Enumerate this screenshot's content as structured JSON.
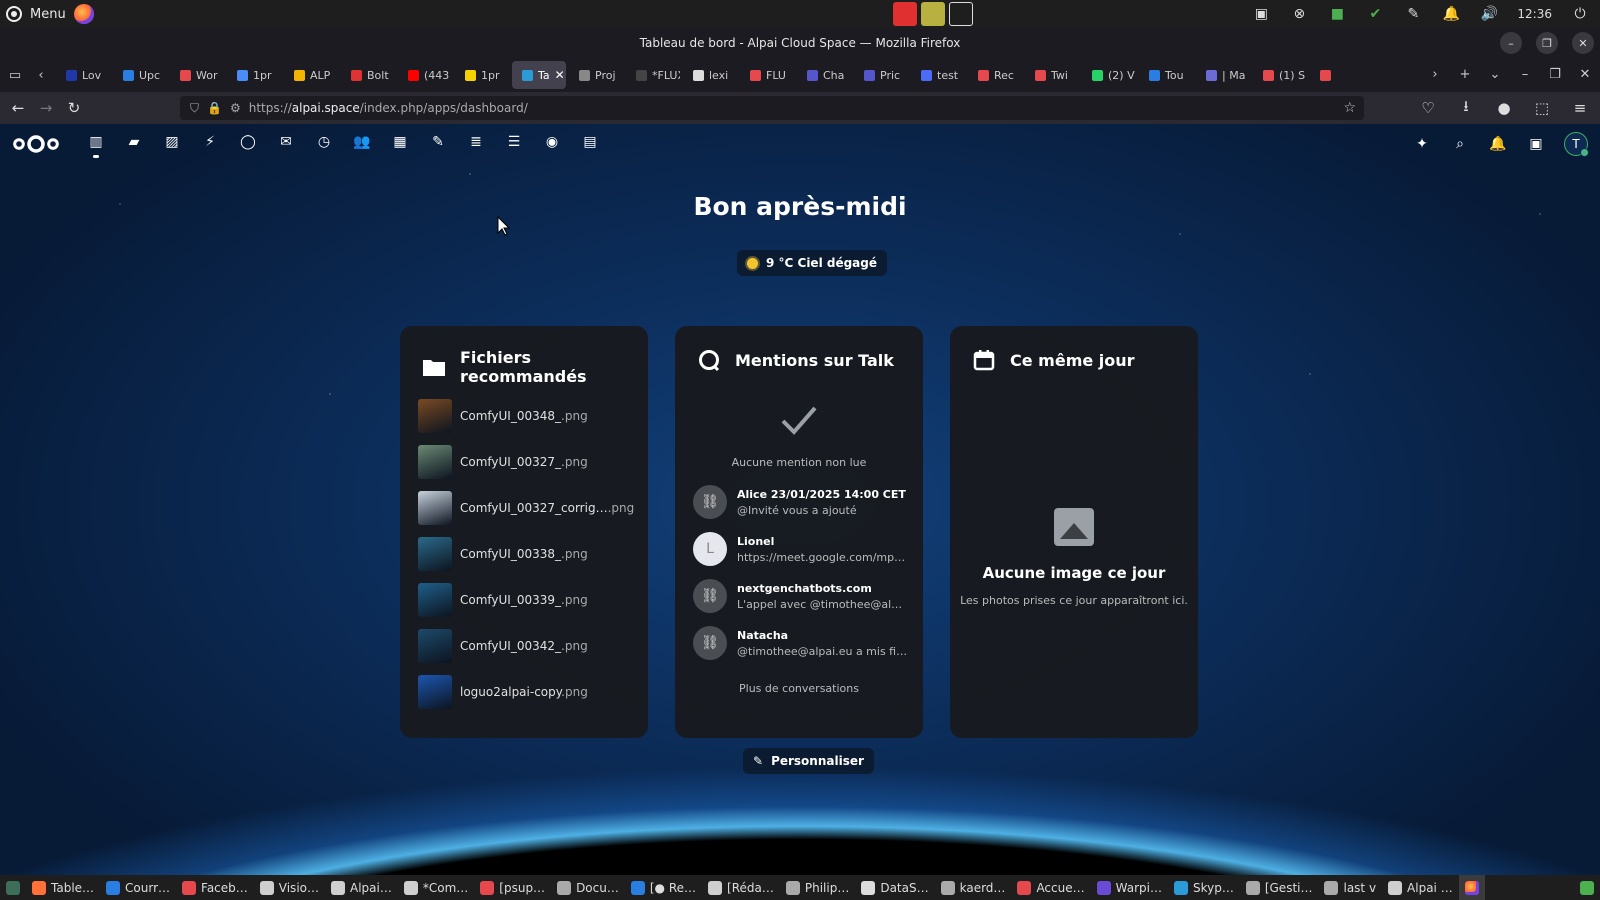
{
  "os": {
    "menu_label": "Menu",
    "clock": "12:36"
  },
  "window": {
    "title": "Tableau de bord - Alpai Cloud Space — Mozilla Firefox"
  },
  "tabs": [
    {
      "label": "Lov",
      "color": "#1f3aa8"
    },
    {
      "label": "Upc",
      "color": "#2a7de1"
    },
    {
      "label": "Wor",
      "color": "#e5484d"
    },
    {
      "label": "1pr",
      "color": "#4a8df6"
    },
    {
      "label": "ALP",
      "color": "#f5b400"
    },
    {
      "label": "Bolt",
      "color": "#d33"
    },
    {
      "label": "(443",
      "color": "#ff0000"
    },
    {
      "label": "1pr",
      "color": "#f5d300"
    },
    {
      "label": "Ta",
      "color": "#2a9bd8",
      "active": true
    },
    {
      "label": "Proj",
      "color": "#888"
    },
    {
      "label": "*FLUX_",
      "color": "#444"
    },
    {
      "label": "lexi",
      "color": "#ddd"
    },
    {
      "label": "FLU",
      "color": "#e5484d"
    },
    {
      "label": "Cha",
      "color": "#5555cc"
    },
    {
      "label": "Pric",
      "color": "#5555cc"
    },
    {
      "label": "test",
      "color": "#4a6cf7"
    },
    {
      "label": "Rec",
      "color": "#e5484d"
    },
    {
      "label": "Twi",
      "color": "#e5484d"
    },
    {
      "label": "(2) V",
      "color": "#25d366"
    },
    {
      "label": "Tou",
      "color": "#2a7de1"
    },
    {
      "label": "| Ma",
      "color": "#6b6bd6"
    },
    {
      "label": "(1) S",
      "color": "#e5484d"
    },
    {
      "label": "",
      "color": "#e5484d"
    }
  ],
  "urlbar": {
    "prefix": "https://",
    "host": "alpai.space",
    "path": "/index.php/apps/dashboard/"
  },
  "dashboard": {
    "greeting": "Bon après-midi",
    "weather": "9 °C Ciel dégagé",
    "customize_label": "Personnaliser",
    "files_panel": {
      "title": "Fichiers recommandés",
      "items": [
        {
          "name": "ComfyUI_00348_",
          "ext": ".png",
          "thumb": "#7a4a22"
        },
        {
          "name": "ComfyUI_00327_",
          "ext": ".png",
          "thumb": "#6b8a74"
        },
        {
          "name": "ComfyUI_00327_corrig…",
          "ext": ".png",
          "thumb": "#c8d3de"
        },
        {
          "name": "ComfyUI_00338_",
          "ext": ".png",
          "thumb": "#2a6a8a"
        },
        {
          "name": "ComfyUI_00339_",
          "ext": ".png",
          "thumb": "#1f5f8a"
        },
        {
          "name": "ComfyUI_00342_",
          "ext": ".png",
          "thumb": "#1d4a6a"
        },
        {
          "name": "loguo2alpai-copy",
          "ext": ".png",
          "thumb": "#1c56b0"
        }
      ]
    },
    "talk_panel": {
      "title": "Mentions sur Talk",
      "empty_text": "Aucune mention non lue",
      "conversations": [
        {
          "title": "Alice 23/01/2025 14:00 CET",
          "sub": "@Invité vous a ajouté",
          "avatar": "link"
        },
        {
          "title": "Lionel",
          "sub": "https://meet.google.com/mpn…",
          "avatar": "L"
        },
        {
          "title": "nextgenchatbots.com",
          "sub": "L'appel avec @timothee@alpa…",
          "avatar": "link"
        },
        {
          "title": "Natacha",
          "sub": "@timothee@alpai.eu a mis fin…",
          "avatar": "link"
        }
      ],
      "more_label": "Plus de conversations"
    },
    "photos_panel": {
      "title": "Ce même jour",
      "empty_title": "Aucune image ce jour",
      "empty_desc": "Les photos prises ce jour apparaîtront ici."
    }
  },
  "nc_header": {
    "avatar_letter": "T",
    "apps": [
      "dashboard-icon",
      "files-icon",
      "photos-icon",
      "activity-icon",
      "talk-icon",
      "mail-icon",
      "deck-icon",
      "contacts-icon",
      "calendar-icon",
      "notes-icon",
      "stack-icon",
      "tasks-icon",
      "circles-icon",
      "calendar2-icon"
    ]
  },
  "taskbar": [
    {
      "label": "Table…",
      "color": "#ff7139",
      "active": false
    },
    {
      "label": "Courr…",
      "color": "#2a7de1"
    },
    {
      "label": "Faceb…",
      "color": "#e5484d"
    },
    {
      "label": "Visio…",
      "color": "#cfcfcf"
    },
    {
      "label": "Alpai…",
      "color": "#cfcfcf"
    },
    {
      "label": "*Com…",
      "color": "#cfcfcf"
    },
    {
      "label": "[psup…",
      "color": "#e5484d"
    },
    {
      "label": "Docu…",
      "color": "#aaa"
    },
    {
      "label": "[● Re…",
      "color": "#2a7de1"
    },
    {
      "label": "[Réda…",
      "color": "#cfcfcf"
    },
    {
      "label": "Philip…",
      "color": "#aaa"
    },
    {
      "label": "DataS…",
      "color": "#ddd"
    },
    {
      "label": "kaerd…",
      "color": "#aaa"
    },
    {
      "label": "Accue…",
      "color": "#e5484d"
    },
    {
      "label": "Warpi…",
      "color": "#6b4bd6"
    },
    {
      "label": "Skyp…",
      "color": "#2a9bd8"
    },
    {
      "label": "[Gesti…",
      "color": "#aaa"
    },
    {
      "label": "last v",
      "color": "#aaa"
    },
    {
      "label": "Alpai …",
      "color": "#cfcfcf"
    }
  ]
}
